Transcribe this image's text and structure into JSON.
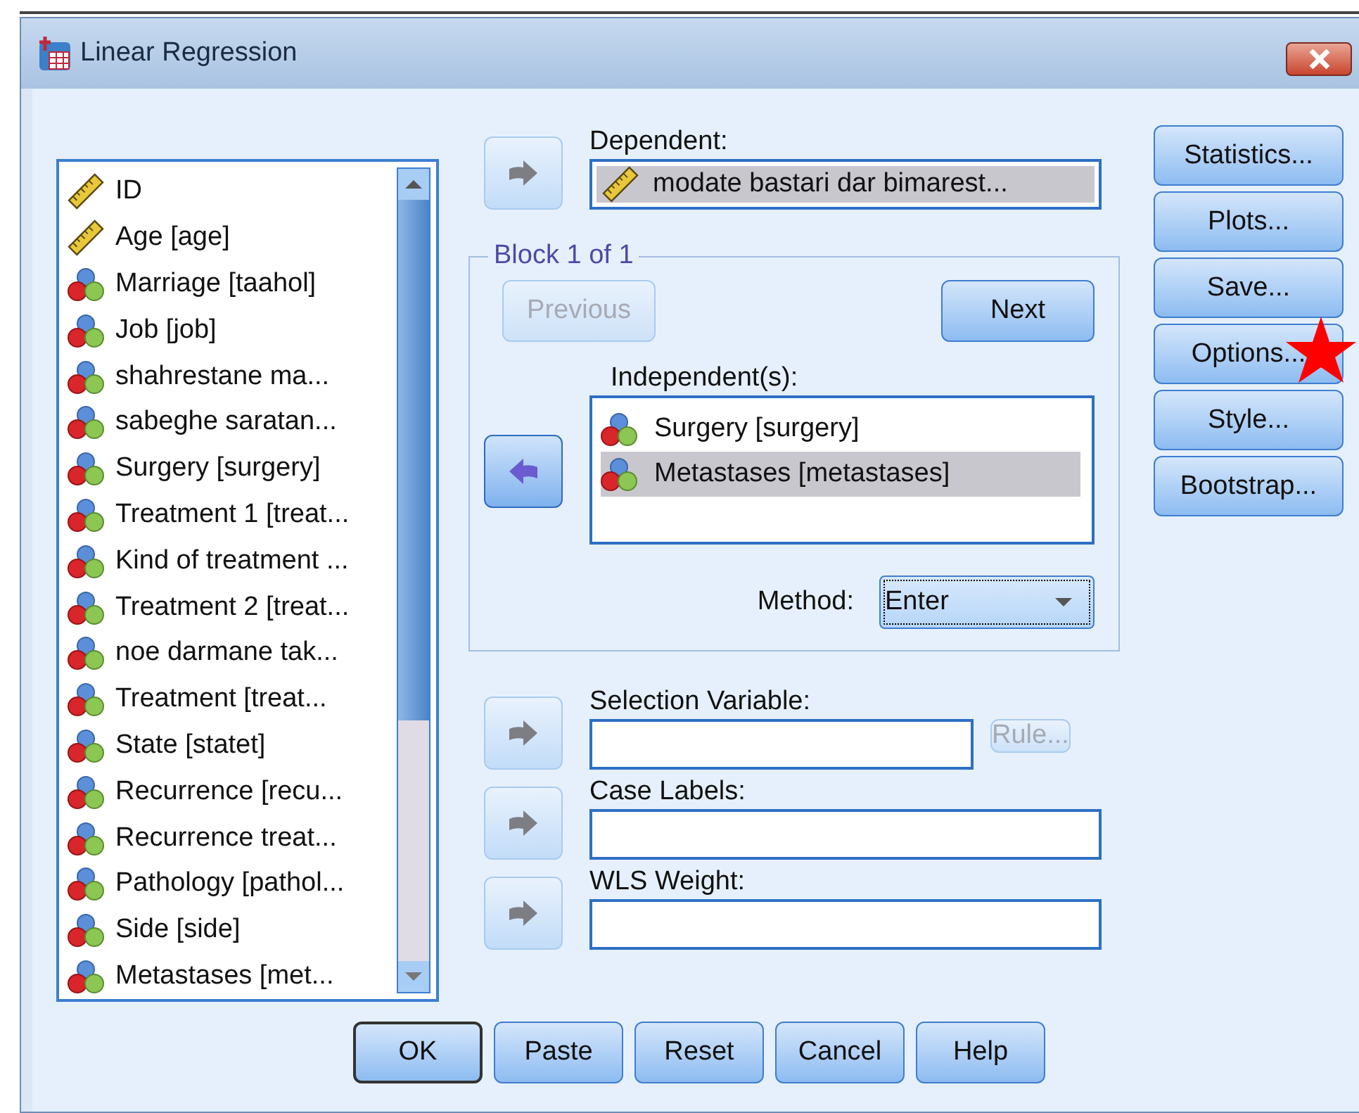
{
  "window": {
    "title": "Linear Regression"
  },
  "variables": [
    {
      "label": "ID",
      "kind": "scale"
    },
    {
      "label": "Age [age]",
      "kind": "scale"
    },
    {
      "label": "Marriage [taahol]",
      "kind": "nominal"
    },
    {
      "label": "Job [job]",
      "kind": "nominal"
    },
    {
      "label": "shahrestane ma...",
      "kind": "nominal"
    },
    {
      "label": "sabeghe saratan...",
      "kind": "nominal"
    },
    {
      "label": "Surgery [surgery]",
      "kind": "nominal"
    },
    {
      "label": "Treatment 1 [treat...",
      "kind": "nominal"
    },
    {
      "label": "Kind of treatment ...",
      "kind": "nominal"
    },
    {
      "label": "Treatment 2 [treat...",
      "kind": "nominal"
    },
    {
      "label": "noe darmane tak...",
      "kind": "nominal"
    },
    {
      "label": "Treatment [treat...",
      "kind": "nominal"
    },
    {
      "label": "State [statet]",
      "kind": "nominal"
    },
    {
      "label": "Recurrence [recu...",
      "kind": "nominal"
    },
    {
      "label": "Recurrence treat...",
      "kind": "nominal"
    },
    {
      "label": "Pathology [pathol...",
      "kind": "nominal"
    },
    {
      "label": "Side [side]",
      "kind": "nominal"
    },
    {
      "label": "Metastases [met...",
      "kind": "nominal"
    }
  ],
  "dependent": {
    "arrow": {
      "kind": "right",
      "disabled": true
    },
    "label": "Dependent:",
    "value": {
      "label": "modate bastari dar bimarest...",
      "kind": "scale"
    }
  },
  "block": {
    "title": "Block 1 of 1",
    "previous": {
      "label": "Previous",
      "disabled": true
    },
    "next": {
      "label": "Next",
      "disabled": false
    },
    "arrow": {
      "kind": "left",
      "disabled": false
    },
    "independents_label": "Independent(s):",
    "independents": [
      {
        "label": "Surgery [surgery]",
        "kind": "nominal",
        "selected": false
      },
      {
        "label": "Metastases [metastases]",
        "kind": "nominal",
        "selected": true
      }
    ],
    "method_label": "Method:",
    "method": "Enter"
  },
  "selection_variable": {
    "arrow": {
      "kind": "right",
      "disabled": true
    },
    "label": "Selection Variable:",
    "rule": {
      "label": "Rule...",
      "disabled": true
    }
  },
  "case_labels": {
    "arrow": {
      "kind": "right",
      "disabled": true
    },
    "label": "Case Labels:"
  },
  "wls_weight": {
    "arrow": {
      "kind": "right",
      "disabled": true
    },
    "label": "WLS Weight:"
  },
  "side_buttons": [
    {
      "label": "Statistics...",
      "starred": false
    },
    {
      "label": "Plots...",
      "starred": false
    },
    {
      "label": "Save...",
      "starred": false
    },
    {
      "label": "Options...",
      "starred": true
    },
    {
      "label": "Style...",
      "starred": false
    },
    {
      "label": "Bootstrap...",
      "starred": false
    }
  ],
  "bottom_buttons": [
    {
      "label": "OK",
      "default": true
    },
    {
      "label": "Paste",
      "default": false
    },
    {
      "label": "Reset",
      "default": false
    },
    {
      "label": "Cancel",
      "default": false
    },
    {
      "label": "Help",
      "default": false
    }
  ]
}
